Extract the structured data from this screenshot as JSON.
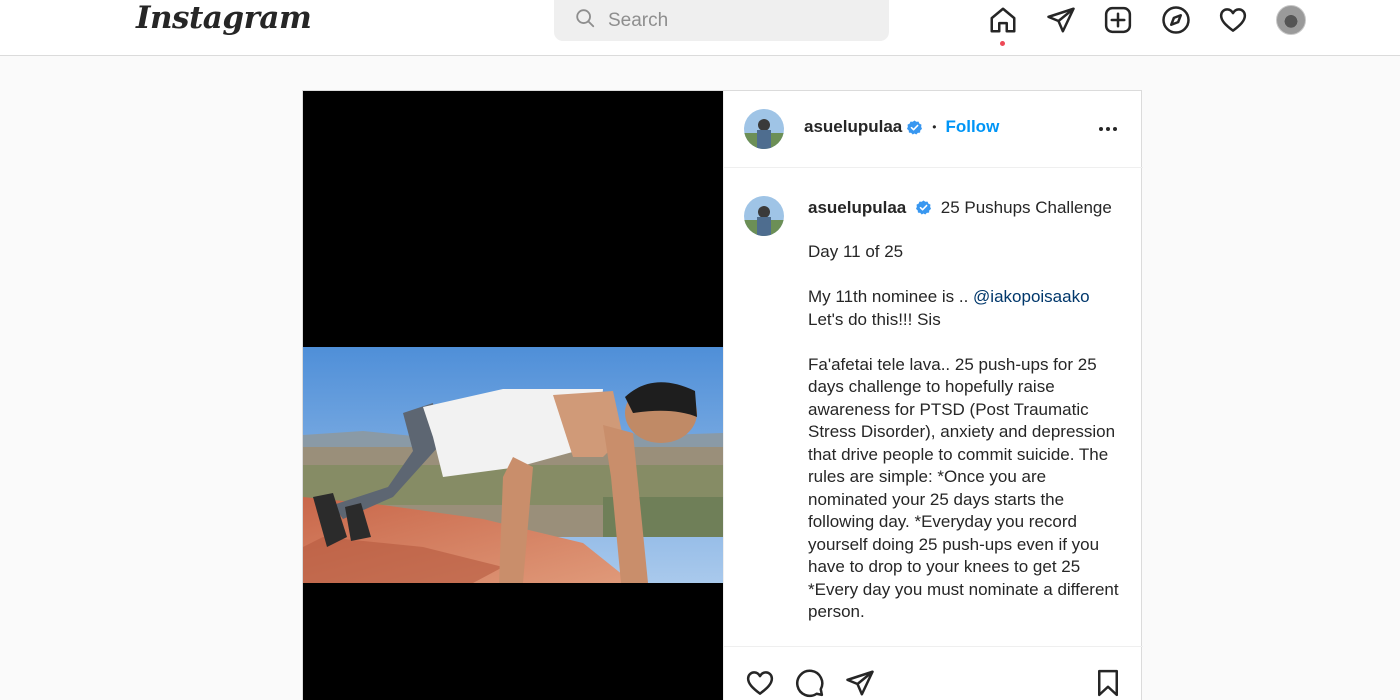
{
  "app": {
    "logo_text": "Instagram"
  },
  "search": {
    "placeholder": "Search"
  },
  "nav": {
    "icons": [
      "home-icon",
      "direct-message-icon",
      "new-post-icon",
      "explore-icon",
      "activity-heart-icon",
      "profile-avatar"
    ]
  },
  "post": {
    "author": "asuelupulaa",
    "follow_label": "Follow",
    "separator": "•",
    "caption_title": "25 Pushups Challenge",
    "caption_day": "Day 11 of 25",
    "nominee_prefix": "My 11th nominee is .. ",
    "nominee_mention": "@iakopoisaako",
    "nominee_line2": "Let's do this!!! Sis",
    "caption_body": "Fa'afetai tele lava.. 25 push-ups for 25 days challenge to hopefully raise awareness for PTSD (Post Traumatic Stress Disorder), anxiety and depression that drive people to commit suicide. The rules are simple: *Once you are nominated your 25 days starts the following day. *Everyday you record yourself doing 25 push-ups even if you have to drop to your knees to get 25 *Every day you must nominate a different person."
  },
  "colors": {
    "accent": "#0095f6",
    "notification_dot": "#ed4956",
    "verified": "#3897f0"
  }
}
